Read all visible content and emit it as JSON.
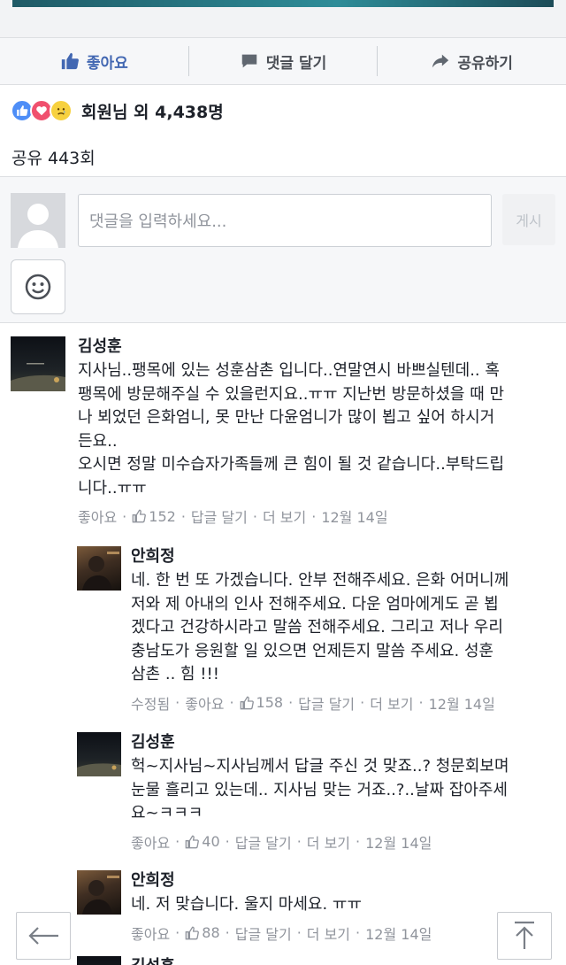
{
  "action_bar": {
    "like_label": "좋아요",
    "comment_label": "댓글 달기",
    "share_label": "공유하기"
  },
  "reactions": {
    "summary": "회원님 외 4,438명",
    "icons": [
      "like-icon",
      "love-icon",
      "sad-icon"
    ]
  },
  "shares_text": "공유 443회",
  "composer": {
    "placeholder": "댓글을 입력하세요...",
    "post_label": "게시"
  },
  "comments": [
    {
      "author": "김성훈",
      "text": "지사님..팽목에 있는 성훈삼촌 입니다..연말연시 바쁘실텐데.. 혹\n팽목에 방문해주실 수 있을런지요..ㅠㅠ 지난번 방문하셨을 때 만\n나 뵈었던 은화엄니, 못 만난 다윤엄니가 많이 뵙고 싶어 하시거\n든요..\n오시면 정말 미수습자가족들께 큰 힘이 될 것 같습니다..부탁드립\n니다..ㅠㅠ",
      "edited": "",
      "like_action": "좋아요",
      "like_count": "152",
      "reply_action": "답글 달기",
      "more_action": "더 보기",
      "date": "12월 14일"
    },
    {
      "author": "안희정",
      "text": "네. 한 번 또 가겠습니다. 안부 전해주세요. 은화 어머니께\n저와 제 아내의 인사 전해주세요. 다운 엄마에게도 곧 뵙\n겠다고 건강하시라고 말씀 전해주세요. 그리고 저나 우리\n충남도가 응원할 일 있으면 언제든지 말씀 주세요. 성훈\n삼촌 .. 힘 !!!",
      "edited": "수정됨",
      "like_action": "좋아요",
      "like_count": "158",
      "reply_action": "답글 달기",
      "more_action": "더 보기",
      "date": "12월 14일"
    },
    {
      "author": "김성훈",
      "text": "헉~지사님~지사님께서 답글 주신 것 맞죠..? 청문회보며\n눈물 흘리고 있는데.. 지사님 맞는 거죠..?..날짜 잡아주세\n요~ㅋㅋㅋ",
      "edited": "",
      "like_action": "좋아요",
      "like_count": "40",
      "reply_action": "답글 달기",
      "more_action": "더 보기",
      "date": "12월 14일"
    },
    {
      "author": "안희정",
      "text": "네. 저 맞습니다. 울지 마세요. ㅠㅠ",
      "edited": "",
      "like_action": "좋아요",
      "like_count": "88",
      "reply_action": "답글 달기",
      "more_action": "더 보기",
      "date": "12월 14일"
    },
    {
      "author": "김성훈"
    }
  ],
  "colors": {
    "facebook_blue": "#4267b2",
    "meta_gray": "#90949c",
    "text": "#1d2129"
  }
}
